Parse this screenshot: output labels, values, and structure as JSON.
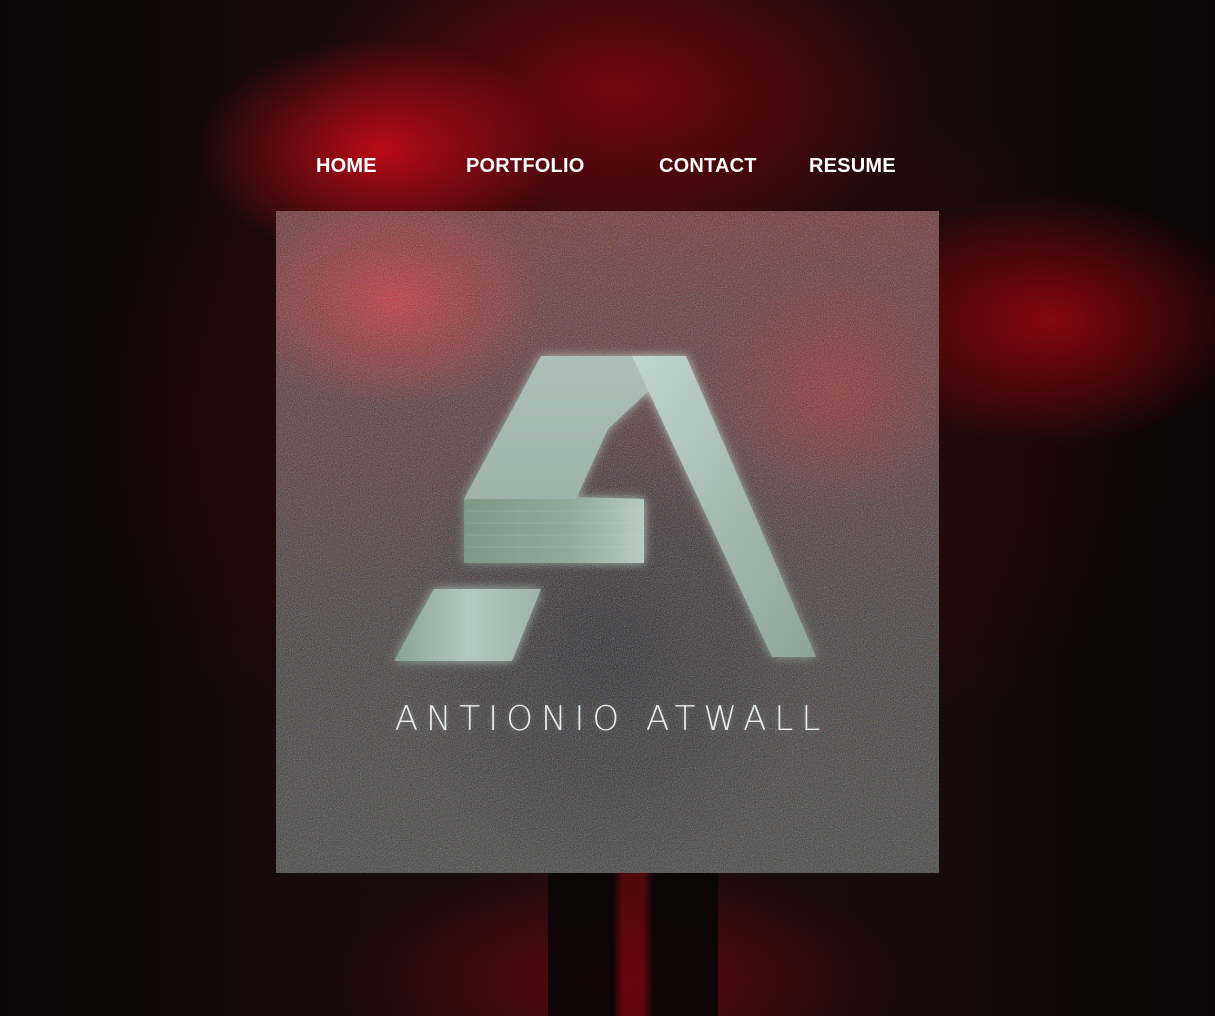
{
  "nav": {
    "items": [
      {
        "label": "HOME"
      },
      {
        "label": "PORTFOLIO"
      },
      {
        "label": "CONTACT"
      },
      {
        "label": "RESUME"
      }
    ]
  },
  "hero": {
    "logo_icon": "letter-a-logo",
    "brand_name": "ANTIONIO ATWALL"
  },
  "colors": {
    "accent_red": "#c8101e",
    "logo_mint": "#a8bdb5",
    "nav_text": "#ffffff"
  }
}
